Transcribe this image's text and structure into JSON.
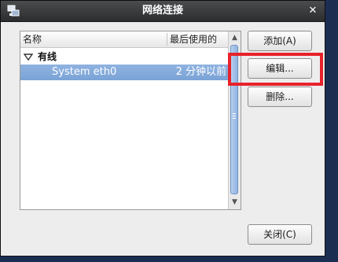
{
  "window": {
    "title": "网络连接",
    "app_icon": "network-connections-icon",
    "close_symbol": "✕"
  },
  "list": {
    "columns": [
      {
        "label": "名称"
      },
      {
        "label": "最后使用的"
      }
    ],
    "groups": [
      {
        "label": "有线",
        "expanded": true,
        "connections": [
          {
            "name": "System eth0",
            "last_used": "2 分钟以前",
            "selected": true
          }
        ]
      }
    ]
  },
  "buttons": {
    "add": "添加(A)",
    "edit": "编辑...",
    "delete": "删除...",
    "close": "关闭(C)"
  },
  "annotation": {
    "color": "#e8222a",
    "target": "edit-button"
  }
}
